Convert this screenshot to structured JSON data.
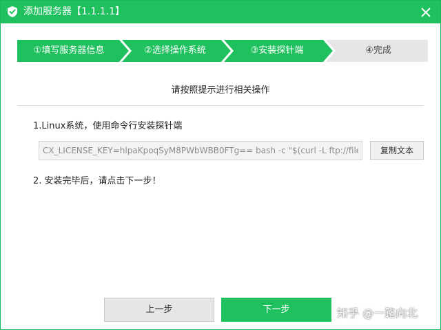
{
  "window": {
    "title": "添加服务器【1.1.1.1】"
  },
  "steps": [
    {
      "label": "①填写服务器信息",
      "state": "active"
    },
    {
      "label": "②选择操作系统",
      "state": "active"
    },
    {
      "label": "③安装探针端",
      "state": "active"
    },
    {
      "label": "④完成",
      "state": "inactive"
    }
  ],
  "main": {
    "instruction": "请按照提示进行相关操作",
    "step1_text": "1.Linux系统，使用命令行安装探针端",
    "command_value": "CX_LICENSE_KEY=hlpaKpoqSyM8PWbWBB0FTg== bash -c \"$(curl -L ftp://file.clo",
    "copy_button": "复制文本",
    "step2_text": "2. 安装完毕后，请点击下一步！"
  },
  "footer": {
    "prev_button": "上一步",
    "next_button": "下一步"
  },
  "watermark": "知乎 @一路向北",
  "colors": {
    "accent": "#1fc15f",
    "inactive_step": "#e6e6e6"
  },
  "icons": {
    "logo": "shield-check-icon",
    "close": "close-icon"
  }
}
